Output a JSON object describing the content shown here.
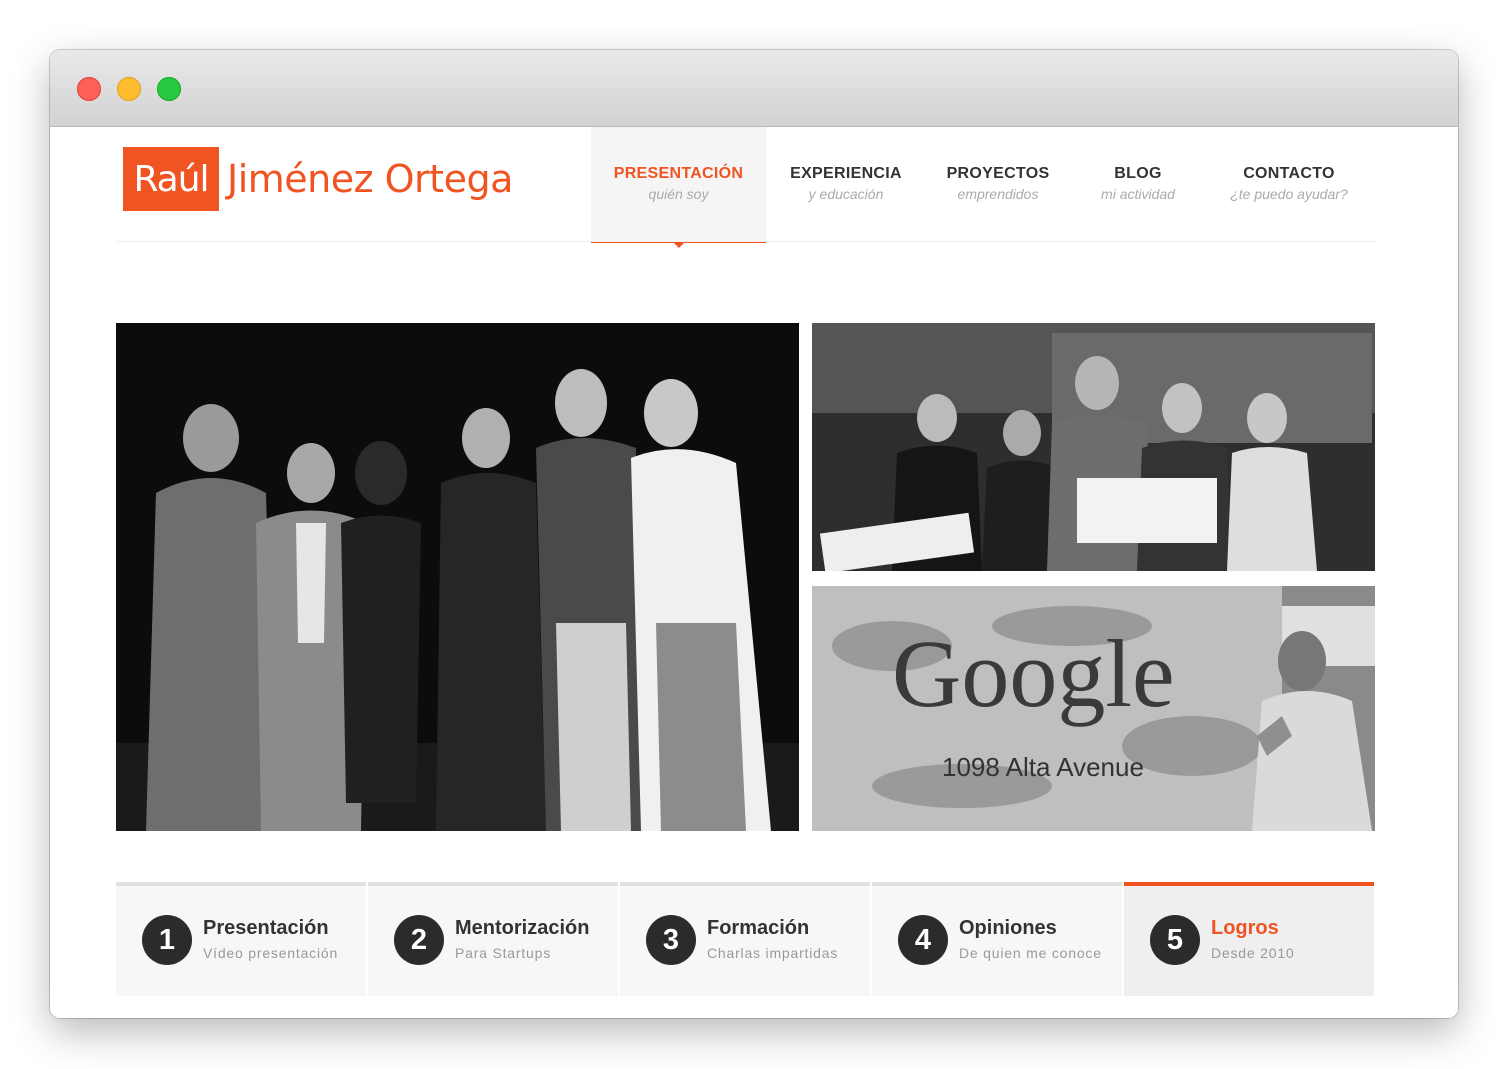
{
  "window": {
    "controls": [
      "close-dot",
      "minimize-dot",
      "zoom-dot"
    ]
  },
  "logo": {
    "first": "Raúl",
    "rest": "Jiménez Ortega"
  },
  "nav": {
    "items": [
      {
        "title": "PRESENTACIÓN",
        "sub": "quién soy",
        "active": true
      },
      {
        "title": "EXPERIENCIA",
        "sub": "y educación",
        "active": false
      },
      {
        "title": "PROYECTOS",
        "sub": "emprendidos",
        "active": false
      },
      {
        "title": "BLOG",
        "sub": "mi actividad",
        "active": false
      },
      {
        "title": "CONTACTO",
        "sub": "¿te puedo ayudar?",
        "active": false
      }
    ]
  },
  "photos": {
    "google_sign_text": "Google",
    "google_address_text": "1098 Alta Avenue"
  },
  "tabs": [
    {
      "num": "1",
      "title": "Presentación",
      "sub": "Vídeo presentación",
      "active": false
    },
    {
      "num": "2",
      "title": "Mentorización",
      "sub": "Para Startups",
      "active": false
    },
    {
      "num": "3",
      "title": "Formación",
      "sub": "Charlas impartidas",
      "active": false
    },
    {
      "num": "4",
      "title": "Opiniones",
      "sub": "De quien me conoce",
      "active": false
    },
    {
      "num": "5",
      "title": "Logros",
      "sub": "Desde 2010",
      "active": true
    }
  ],
  "colors": {
    "accent": "#f05423",
    "dark": "#2b2b2b"
  }
}
